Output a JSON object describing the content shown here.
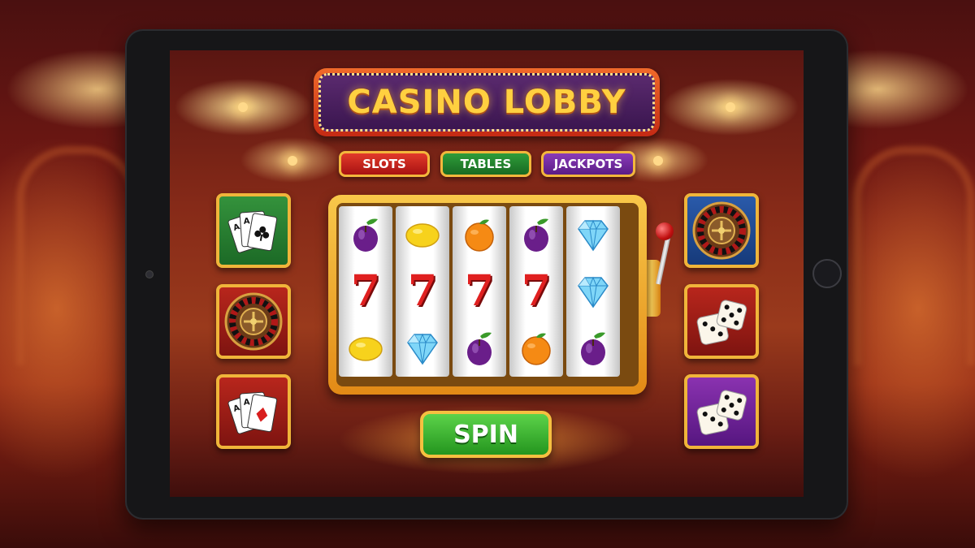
{
  "lobby": {
    "title": "CASINO LOBBY",
    "tabs": [
      {
        "label": "SLOTS",
        "color": "#c82020"
      },
      {
        "label": "TABLES",
        "color": "#258a30"
      },
      {
        "label": "JACKPOTS",
        "color": "#7a2aa8"
      }
    ],
    "spin_label": "SPIN"
  },
  "left_tiles": [
    {
      "icon": "cards-clubs-icon",
      "color": "#2a8a34"
    },
    {
      "icon": "roulette-wheel-icon",
      "color": "#a81e16"
    },
    {
      "icon": "cards-diamonds-icon",
      "color": "#a81e16"
    }
  ],
  "right_tiles": [
    {
      "icon": "roulette-wheel-icon",
      "color": "#244e9a"
    },
    {
      "icon": "dice-icon",
      "color": "#a81e16"
    },
    {
      "icon": "dice-icon",
      "color": "#7a2aa8"
    }
  ],
  "reels": [
    [
      "plum",
      "seven",
      "lemon"
    ],
    [
      "lemon",
      "seven",
      "diamond"
    ],
    [
      "orange",
      "seven",
      "plum"
    ],
    [
      "plum",
      "seven",
      "orange"
    ],
    [
      "diamond",
      "diamond",
      "plum"
    ]
  ],
  "symbols": {
    "seven": "7"
  }
}
